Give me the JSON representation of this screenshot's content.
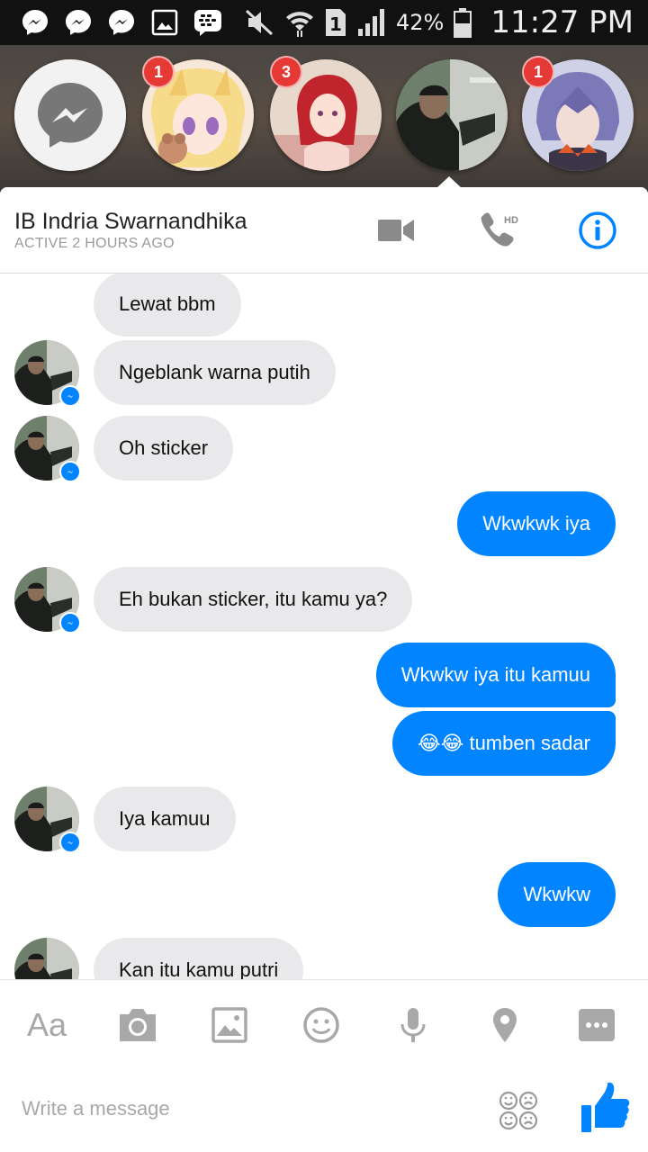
{
  "status_bar": {
    "battery": "42%",
    "time": "11:27 PM",
    "sim": "1"
  },
  "chat_heads": [
    {
      "name": "messenger-home",
      "badge": ""
    },
    {
      "name": "chat-head-anime-girl-blonde",
      "badge": "1"
    },
    {
      "name": "chat-head-anime-girl-redhead",
      "badge": "3"
    },
    {
      "name": "chat-head-ib-indria",
      "badge": ""
    },
    {
      "name": "chat-head-anime-boy",
      "badge": "1"
    }
  ],
  "header": {
    "contact_name": "IB Indria Swarnandhika",
    "status": "ACTIVE 2 HOURS AGO",
    "hd_label": "HD"
  },
  "messages": [
    {
      "side": "in",
      "text": "Lewat bbm",
      "avatar": false
    },
    {
      "side": "in",
      "text": "Ngeblank warna putih",
      "avatar": true
    },
    {
      "side": "in",
      "text": "Oh sticker",
      "avatar": true
    },
    {
      "side": "out",
      "text": "Wkwkwk iya"
    },
    {
      "side": "in",
      "text": "Eh bukan sticker, itu kamu ya?",
      "avatar": true
    },
    {
      "side": "out",
      "text": "Wkwkw iya itu kamuu"
    },
    {
      "side": "out",
      "text": "😂😂 tumben sadar"
    },
    {
      "side": "in",
      "text": "Iya kamuu",
      "avatar": true
    },
    {
      "side": "out",
      "text": "Wkwkw"
    },
    {
      "side": "in",
      "text": "Kan itu kamu putri",
      "avatar": true
    }
  ],
  "composer": {
    "aa_label": "Aa",
    "placeholder": "Write a message"
  },
  "colors": {
    "accent": "#0084ff",
    "incoming_bubble": "#e9e9eb",
    "badge": "#e53935"
  }
}
